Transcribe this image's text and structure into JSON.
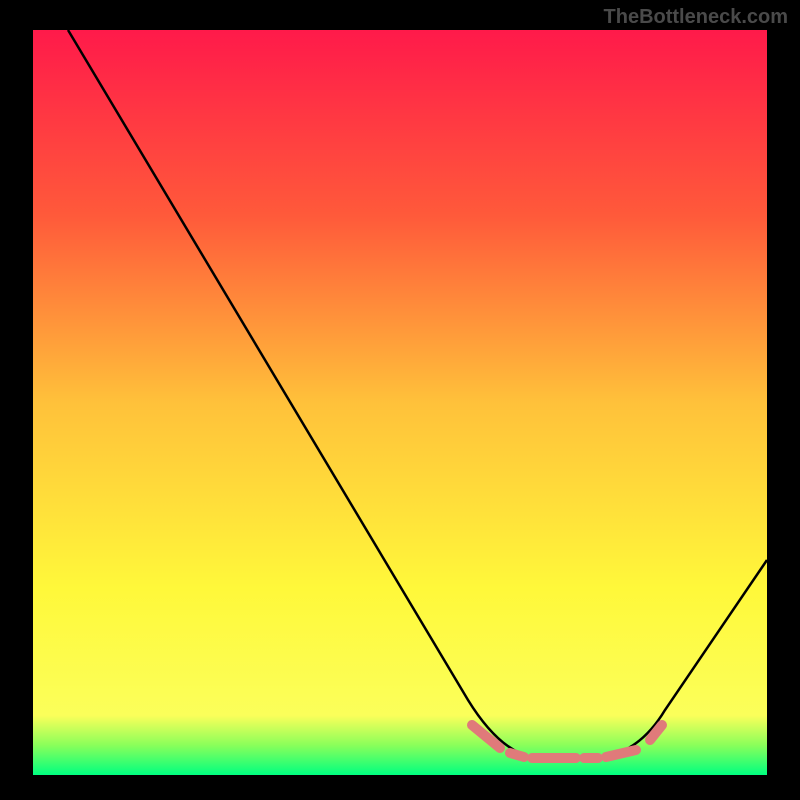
{
  "watermark": "TheBottleneck.com",
  "chart_data": {
    "type": "line",
    "title": "",
    "xlabel": "",
    "ylabel": "",
    "xlim": [
      0,
      100
    ],
    "ylim": [
      0,
      100
    ],
    "background": {
      "type": "vertical-gradient",
      "stops": [
        {
          "offset": 0.0,
          "color": "#ff1a4a"
        },
        {
          "offset": 0.25,
          "color": "#ff5a3a"
        },
        {
          "offset": 0.5,
          "color": "#ffc13a"
        },
        {
          "offset": 0.75,
          "color": "#fff83a"
        },
        {
          "offset": 0.92,
          "color": "#fbff5a"
        },
        {
          "offset": 0.97,
          "color": "#8aff5a"
        },
        {
          "offset": 1.0,
          "color": "#00ff80"
        }
      ]
    },
    "series": [
      {
        "name": "bottleneck-curve",
        "color": "#000000",
        "points": [
          {
            "x": 5,
            "y": 100
          },
          {
            "x": 60,
            "y": 8
          },
          {
            "x": 68,
            "y": 2
          },
          {
            "x": 78,
            "y": 2
          },
          {
            "x": 84,
            "y": 6
          },
          {
            "x": 100,
            "y": 30
          }
        ]
      }
    ],
    "marker_band": {
      "name": "optimal-range",
      "color": "#e07a7a",
      "y": 3,
      "x_start": 60,
      "x_end": 85,
      "segments": [
        {
          "x1": 60,
          "x2": 64
        },
        {
          "x1": 65,
          "x2": 67
        },
        {
          "x1": 68,
          "x2": 74
        },
        {
          "x1": 75,
          "x2": 77
        },
        {
          "x1": 78,
          "x2": 82
        },
        {
          "x1": 83.5,
          "x2": 85
        }
      ]
    }
  }
}
